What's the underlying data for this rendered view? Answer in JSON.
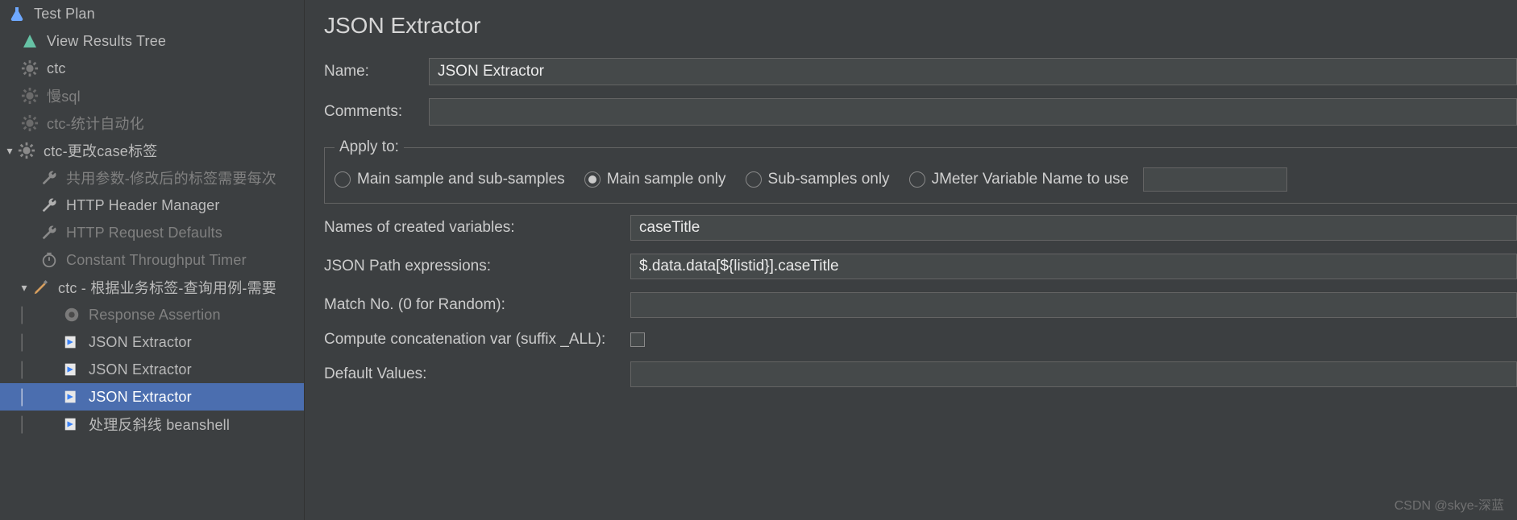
{
  "tree": {
    "root": "Test Plan",
    "items": [
      {
        "label": "View Results Tree",
        "icon": "tree-icon",
        "dim": false
      },
      {
        "label": "ctc",
        "icon": "gear-icon",
        "dim": false
      },
      {
        "label": "慢sql",
        "icon": "gear-icon",
        "dim": true
      },
      {
        "label": "ctc-统计自动化",
        "icon": "gear-icon",
        "dim": true
      },
      {
        "label": "ctc-更改case标签",
        "icon": "gear-icon",
        "dim": false,
        "expanded": true
      },
      {
        "label": "共用参数-修改后的标签需要每次",
        "icon": "wrench-icon",
        "dim": true,
        "child": true
      },
      {
        "label": "HTTP Header Manager",
        "icon": "wrench-icon",
        "dim": false,
        "child": true
      },
      {
        "label": "HTTP Request Defaults",
        "icon": "wrench-icon",
        "dim": true,
        "child": true
      },
      {
        "label": "Constant Throughput Timer",
        "icon": "timer-icon",
        "dim": true,
        "child": true
      },
      {
        "label": "ctc - 根据业务标签-查询用例-需要",
        "icon": "pencil-icon",
        "dim": false,
        "child": true,
        "expanded": true
      },
      {
        "label": "Response Assertion",
        "icon": "assertion-icon",
        "dim": true,
        "grandchild": true
      },
      {
        "label": "JSON Extractor",
        "icon": "extractor-icon",
        "dim": false,
        "grandchild": true
      },
      {
        "label": "JSON Extractor",
        "icon": "extractor-icon",
        "dim": false,
        "grandchild": true
      },
      {
        "label": "JSON Extractor",
        "icon": "extractor-icon",
        "dim": false,
        "grandchild": true,
        "selected": true
      },
      {
        "label": "处理反斜线 beanshell",
        "icon": "extractor-icon",
        "dim": false,
        "grandchild": true
      }
    ]
  },
  "main": {
    "title": "JSON Extractor",
    "name_label": "Name:",
    "name_value": "JSON Extractor",
    "comments_label": "Comments:",
    "comments_value": "",
    "apply_to_label": "Apply to:",
    "radio_options": [
      {
        "label": "Main sample and sub-samples",
        "checked": false
      },
      {
        "label": "Main sample only",
        "checked": true
      },
      {
        "label": "Sub-samples only",
        "checked": false
      },
      {
        "label": "JMeter Variable Name to use",
        "checked": false,
        "has_input": true
      }
    ],
    "fields": {
      "names_label": "Names of created variables:",
      "names_value": "caseTitle",
      "json_path_label": "JSON Path expressions:",
      "json_path_value": "$.data.data[${listid}].caseTitle",
      "match_no_label": "Match No. (0 for Random):",
      "match_no_value": "",
      "concat_label": "Compute concatenation var (suffix _ALL):",
      "concat_checked": false,
      "default_label": "Default Values:",
      "default_value": ""
    }
  },
  "watermark": "CSDN @skye-深蓝"
}
